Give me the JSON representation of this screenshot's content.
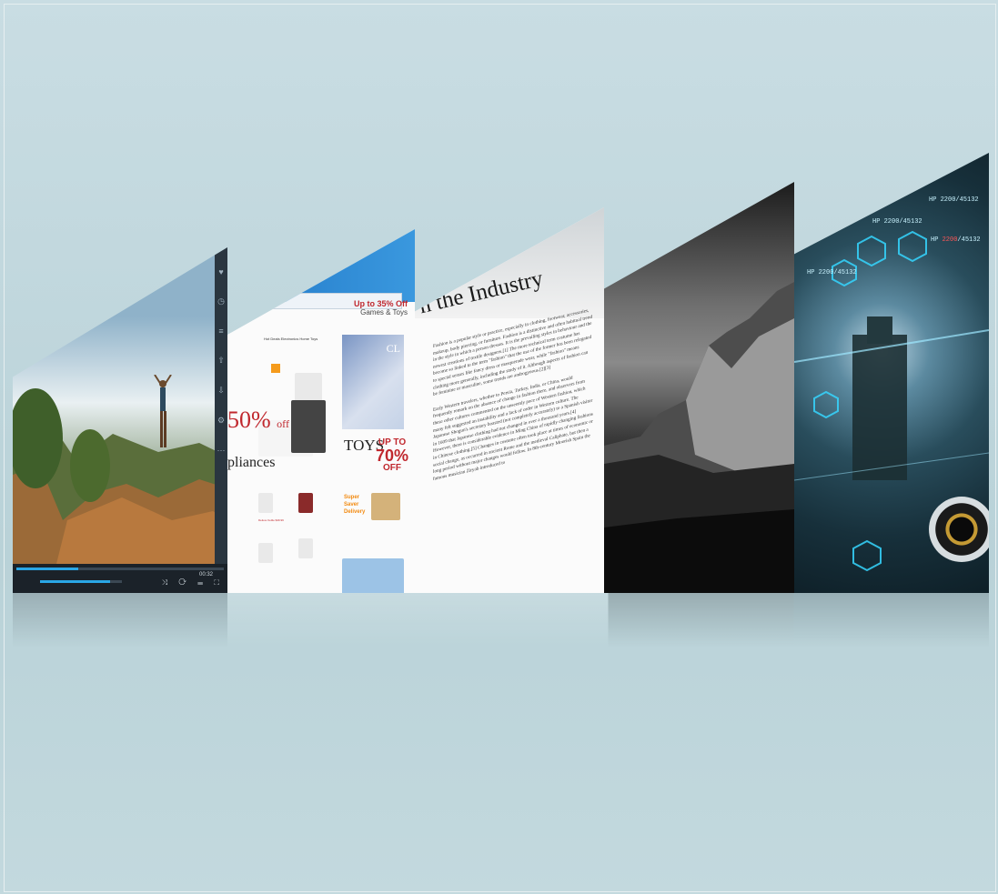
{
  "scene": "floating app screens",
  "video_player": {
    "time_display": "00:32",
    "seek_progress": 0.3,
    "volume_level": 0.85,
    "sidebar_icons": [
      "favorite-icon",
      "history-icon",
      "playlist-icon",
      "share-icon",
      "download-icon",
      "settings-icon",
      "more-icon"
    ],
    "control_icons": [
      "shuffle-icon",
      "repeat-icon",
      "equalizer-icon",
      "subtitle-icon",
      "fullscreen-icon"
    ],
    "control_glyphs": "⤨ ⟳ ☰ ⛶"
  },
  "shopping_page": {
    "promo_title": "Up to 35% Off",
    "promo_subtitle": "Games & Toys",
    "nav_text": "Hot Deals  Electronics  Home  Toys",
    "sale_percent": "50%",
    "sale_suffix": "off",
    "appliances": "pliances",
    "ad_text": "CL",
    "toys_label": "TOYS",
    "toys_up_to": "UP TO",
    "toys_percent": "70%",
    "toys_off": "OFF",
    "delivery": "Super Saver Delivery",
    "product_price": "Deluxe Kettle $49.99"
  },
  "article_page": {
    "heading": "n the Industry",
    "paragraph1": "Fashion is a popular style or practice, especially in clothing, footwear, accessories, makeup, body piercing, or furniture. Fashion is a distinctive and often habitual trend in the style in which a person dresses. It is the prevailing styles in behaviour and the newest creations of textile designers.[1] The more technical term costume has become so linked to the term \"fashion\" that the use of the former has been relegated to special senses like fancy dress or masquerade wear, while \"fashion\" means clothing more generally, including the study of it. Although aspects of fashion can be feminine or masculine, some trends are androgynous.[2][3]",
    "paragraph2": "Early Western travelers, whether to Persia, Turkey, India, or China, would frequently remark on the absence of change in fashion there, and observers from these other cultures commented on the unseemly pace of Western fashion, which many felt suggested an instability and a lack of order in Western culture. The Japanese Shogun's secretary boasted (not completely accurately) to a Spanish visitor in 1609 that Japanese clothing had not changed in over a thousand years.[4] However, there is considerable evidence in Ming China of rapidly changing fashions in Chinese clothing.[5] Changes in costume often took place at times of economic or social change, as occurred in ancient Rome and the medieval Caliphate, but then a long period without major changes would follow. In 8th-century Moorish Spain the famous musician Ziryab introduced to"
  },
  "game_screen": {
    "hp_top": "HP 2200/45132",
    "hp_top2": "HP 2200/45132",
    "hp_mid": "HP 2200/45132",
    "hp_mid_red": "2200",
    "hp_small": "HP 2200/45132",
    "hud_color": "#36d6ff",
    "accent_color": "#ff4a4a"
  }
}
